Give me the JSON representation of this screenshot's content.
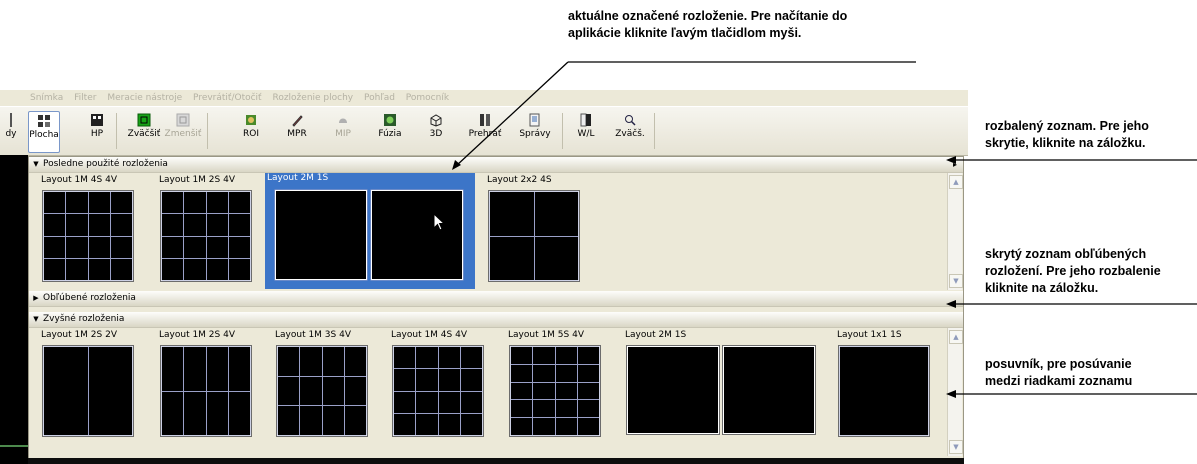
{
  "annotations": {
    "top_line1": "aktuálne označené rozloženie. Pre načítanie do",
    "top_line2": "aplikácie kliknite ľavým tlačidlom myši.",
    "r1_line1": "rozbalený zoznam. Pre jeho",
    "r1_line2": "skrytie, kliknite na záložku.",
    "r2_line1": "skrytý zoznam obľúbených",
    "r2_line2": "rozložení. Pre jeho rozbalenie",
    "r2_line3": "kliknite na záložku.",
    "r3_line1": "posuvník, pre posúvanie",
    "r3_line2": "medzi riadkami zoznamu"
  },
  "menu": [
    "Snímka",
    "Filter",
    "Meracie nástroje",
    "Prevrátiť/Otočiť",
    "Rozloženie plochy",
    "Pohľad",
    "Pomocník"
  ],
  "toolbar": {
    "cut_label": "dy",
    "plocha": "Plocha",
    "hp": "HP",
    "zvacsit": "Zväčšiť",
    "zmensit": "Zmenšiť",
    "roi": "ROI",
    "mpr": "MPR",
    "mip": "MIP",
    "fuzia": "Fúzia",
    "three_d": "3D",
    "prehrat": "Prehrať",
    "spravy": "Správy",
    "wl": "W/L",
    "zvacs": "Zväčš."
  },
  "sections": {
    "recent": "Posledne použité rozloženia",
    "favorites": "Obľúbené rozloženia",
    "other": "Zvyšné rozloženia"
  },
  "recent_layouts": [
    {
      "label": "Layout 1M 4S 4V"
    },
    {
      "label": "Layout 1M 2S 4V"
    },
    {
      "label": "Layout 2M 1S"
    },
    {
      "label": "Layout 2x2 4S"
    }
  ],
  "other_layouts": [
    {
      "label": "Layout 1M 2S 2V"
    },
    {
      "label": "Layout 1M 2S 4V"
    },
    {
      "label": "Layout 1M 3S 4V"
    },
    {
      "label": "Layout 1M 4S 4V"
    },
    {
      "label": "Layout 1M 5S 4V"
    },
    {
      "label": "Layout 2M 1S"
    },
    {
      "label": "Layout 1x1 1S"
    }
  ],
  "colors": {
    "selection": "#3c75c8",
    "panel": "#ece9d8"
  }
}
